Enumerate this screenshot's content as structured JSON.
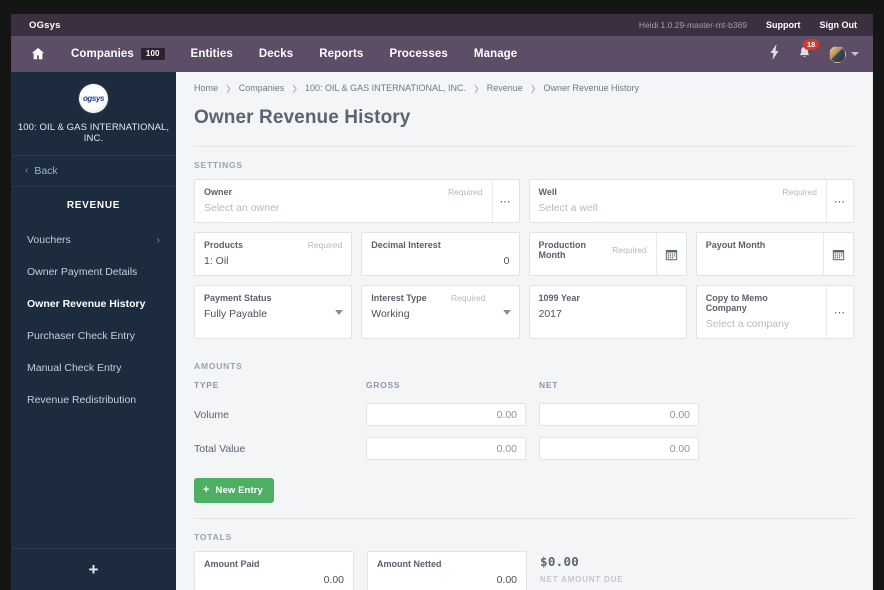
{
  "topbar": {
    "brand": "OGsys",
    "version": "Heidi 1.0.29-master-mt-b369",
    "support": "Support",
    "signout": "Sign Out"
  },
  "nav": {
    "home_icon": "home-icon",
    "items": [
      {
        "label": "Companies",
        "badge": "100"
      },
      {
        "label": "Entities",
        "badge": ""
      },
      {
        "label": "Decks",
        "badge": ""
      },
      {
        "label": "Reports",
        "badge": ""
      },
      {
        "label": "Processes",
        "badge": ""
      },
      {
        "label": "Manage",
        "badge": ""
      }
    ],
    "bolt_icon": "lightning-bolt-icon",
    "bell_icon": "bell-icon",
    "notification_count": "18",
    "avatar_icon": "avatar",
    "caret_icon": "chevron-down-icon"
  },
  "sidebar": {
    "logo_text": "ogsys",
    "company": "100: OIL & GAS INTERNATIONAL, INC.",
    "back": "Back",
    "section": "REVENUE",
    "items": [
      {
        "label": "Vouchers",
        "chevron": "›",
        "active": false
      },
      {
        "label": "Owner Payment Details",
        "chevron": "",
        "active": false
      },
      {
        "label": "Owner Revenue History",
        "chevron": "",
        "active": true
      },
      {
        "label": "Purchaser Check Entry",
        "chevron": "",
        "active": false
      },
      {
        "label": "Manual Check Entry",
        "chevron": "",
        "active": false
      },
      {
        "label": "Revenue Redistribution",
        "chevron": "",
        "active": false
      }
    ],
    "add_label": "+"
  },
  "breadcrumb": [
    "Home",
    "Companies",
    "100: OIL & GAS INTERNATIONAL, INC.",
    "Revenue",
    "Owner Revenue History"
  ],
  "page": {
    "title": "Owner Revenue History"
  },
  "settings": {
    "label": "SETTINGS",
    "fields": {
      "owner": {
        "label": "Owner",
        "value": "Select an owner",
        "placeholder": true,
        "required": "Required",
        "control": "ellipsis"
      },
      "well": {
        "label": "Well",
        "value": "Select a well",
        "placeholder": true,
        "required": "Required",
        "control": "ellipsis"
      },
      "products": {
        "label": "Products",
        "value": "1: Oil",
        "placeholder": false,
        "required": "Required",
        "control": "none"
      },
      "decimal": {
        "label": "Decimal Interest",
        "value": "0",
        "placeholder": false,
        "required": "",
        "control": "none"
      },
      "prod_month": {
        "label": "Production Month",
        "value": "",
        "placeholder": false,
        "required": "Required",
        "control": "calendar"
      },
      "payout_month": {
        "label": "Payout Month",
        "value": "",
        "placeholder": false,
        "required": "",
        "control": "calendar"
      },
      "payment_status": {
        "label": "Payment Status",
        "value": "Fully Payable",
        "placeholder": false,
        "required": "",
        "control": "caret"
      },
      "interest_type": {
        "label": "Interest Type",
        "value": "Working",
        "placeholder": false,
        "required": "Required",
        "control": "caret"
      },
      "year_1099": {
        "label": "1099 Year",
        "value": "2017",
        "placeholder": false,
        "required": "",
        "control": "none"
      },
      "memo_company": {
        "label": "Copy to Memo Company",
        "value": "Select a company",
        "placeholder": true,
        "required": "",
        "control": "ellipsis"
      }
    }
  },
  "amounts": {
    "label": "AMOUNTS",
    "headers": {
      "type": "TYPE",
      "gross": "GROSS",
      "net": "NET"
    },
    "rows": [
      {
        "type": "Volume",
        "gross": "0.00",
        "net": "0.00"
      },
      {
        "type": "Total Value",
        "gross": "0.00",
        "net": "0.00"
      }
    ],
    "new_entry": "New Entry",
    "plus_icon": "plus-icon"
  },
  "totals": {
    "label": "TOTALS",
    "amount_paid": {
      "label": "Amount Paid",
      "value": "0.00"
    },
    "amount_netted": {
      "label": "Amount Netted",
      "value": "0.00"
    },
    "net_due": {
      "value": "$0.00",
      "label": "NET AMOUNT DUE"
    }
  },
  "colors": {
    "topbar": "#3a3040",
    "navbar": "#5d4d66",
    "sidebar": "#1c2b3e",
    "content_bg": "#f4f5f7",
    "accent_green": "#4caf62",
    "badge_red": "#d9372b",
    "logo_blue": "#1b3f8f"
  }
}
